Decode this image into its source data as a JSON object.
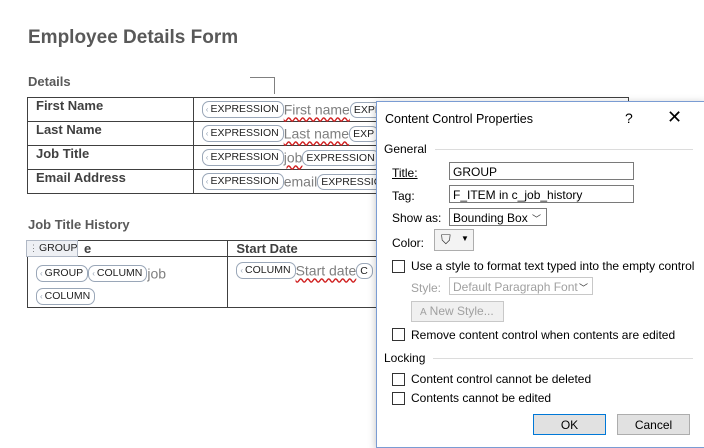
{
  "document": {
    "title": "Employee Details Form",
    "details_heading": "Details",
    "details_rows": [
      {
        "label": "First Name",
        "cc": "EXPRESSION",
        "placeholder": "First name",
        "cc2": "EXPR"
      },
      {
        "label": "Last Name",
        "cc": "EXPRESSION",
        "placeholder": "Last name",
        "cc2": "EXP"
      },
      {
        "label": "Job Title",
        "cc": "EXPRESSION",
        "placeholder": "job",
        "cc2": "EXPRESSION"
      },
      {
        "label": "Email Address",
        "cc": "EXPRESSION",
        "placeholder": "email",
        "cc2": "EXPRESSIO"
      }
    ],
    "history_heading": "Job Title History",
    "group_tag": "GROUP",
    "history_header_first": "e",
    "history_header_second": "Start Date",
    "history_cell1": {
      "cc_group": "GROUP",
      "cc_column": "COLUMN",
      "placeholder": "job",
      "cc_column2": "COLUMN"
    },
    "history_cell2": {
      "cc_column": "COLUMN",
      "placeholder": "Start date",
      "cc_column2": "C"
    }
  },
  "dialog": {
    "title": "Content Control Properties",
    "help_glyph": "?",
    "close_glyph": "✕",
    "general_label": "General",
    "title_label": "Title:",
    "title_value": "GROUP",
    "tag_label": "Tag:",
    "tag_value": "F_ITEM in c_job_history",
    "show_as_label": "Show as:",
    "show_as_value": "Bounding Box",
    "color_label": "Color:",
    "use_style_label": "Use a style to format text typed into the empty control",
    "style_label": "Style:",
    "style_value": "Default Paragraph Font",
    "new_style_label": "New Style...",
    "remove_cc_label": "Remove content control when contents are edited",
    "locking_label": "Locking",
    "cannot_delete_label": "Content control cannot be deleted",
    "cannot_edit_label": "Contents cannot be edited",
    "ok_label": "OK",
    "cancel_label": "Cancel"
  }
}
